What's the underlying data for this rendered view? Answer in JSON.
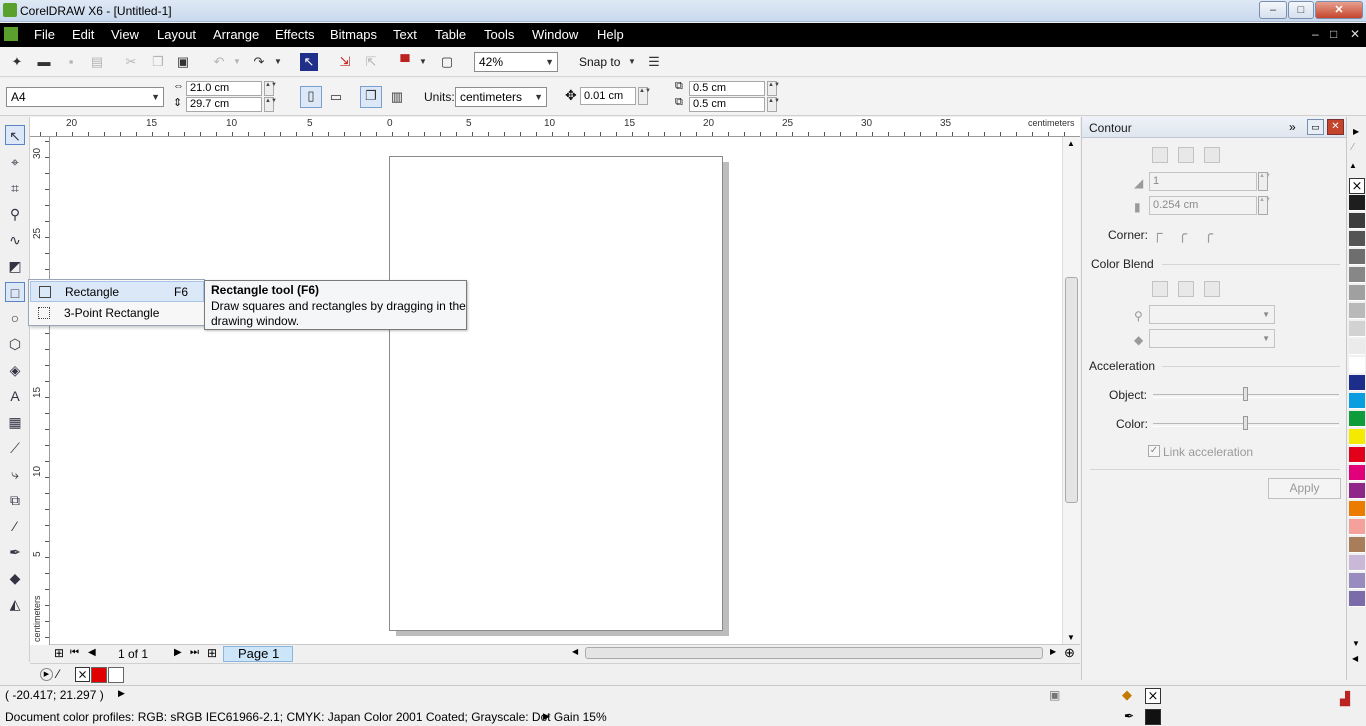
{
  "window": {
    "title": "CorelDRAW X6 - [Untitled-1]",
    "minimize": "–",
    "maximize": "□",
    "close": "✕"
  },
  "menu": [
    {
      "label": "File"
    },
    {
      "label": "Edit"
    },
    {
      "label": "View"
    },
    {
      "label": "Layout"
    },
    {
      "label": "Arrange"
    },
    {
      "label": "Effects"
    },
    {
      "label": "Bitmaps"
    },
    {
      "label": "Text"
    },
    {
      "label": "Table"
    },
    {
      "label": "Tools"
    },
    {
      "label": "Window"
    },
    {
      "label": "Help"
    }
  ],
  "menu_doc_controls": {
    "minimize": "–",
    "restore": "□",
    "close": "✕"
  },
  "standard_toolbar": {
    "zoom": "42%",
    "snap_to": "Snap to",
    "icons": [
      "new-icon",
      "open-icon",
      "save-icon",
      "print-icon",
      "cut-icon",
      "copy-icon",
      "paste-icon",
      "undo-icon",
      "redo-icon",
      "corel-connect-icon",
      "import-icon",
      "export-icon",
      "publish-pdf-icon",
      "app-launcher-icon",
      "full-screen-icon",
      "options-icon"
    ]
  },
  "property_bar": {
    "paper_size": "A4",
    "width": "21.0 cm",
    "height": "29.7 cm",
    "units_label": "Units:",
    "units": "centimeters",
    "nudge": "0.01 cm",
    "dup_x": "0.5 cm",
    "dup_y": "0.5 cm"
  },
  "rulers": {
    "unit_label": "centimeters",
    "h_ticks": [
      "20",
      "15",
      "10",
      "5",
      "0",
      "5",
      "10",
      "15",
      "20",
      "25",
      "30",
      "35"
    ],
    "v_ticks": [
      "30",
      "25",
      "20",
      "15",
      "10",
      "5"
    ]
  },
  "flyout": {
    "items": [
      {
        "label": "Rectangle",
        "shortcut": "F6"
      },
      {
        "label": "3-Point Rectangle",
        "shortcut": ""
      }
    ]
  },
  "tooltip": {
    "title": "Rectangle tool (F6)",
    "body": "Draw squares and rectangles by dragging in the drawing window."
  },
  "page_nav": {
    "counter": "1 of 1",
    "tab": "Page 1"
  },
  "status": {
    "coords": "( -20.417; 21.297 )",
    "color_profiles": "Document color profiles: RGB: sRGB IEC61966-2.1; CMYK: Japan Color 2001 Coated; Grayscale: Dot Gain 15%"
  },
  "docker": {
    "title": "Contour",
    "steps": "1",
    "offset": "0.254 cm",
    "corner_label": "Corner:",
    "color_blend_label": "Color Blend",
    "acceleration_label": "Acceleration",
    "object_label": "Object:",
    "color_label": "Color:",
    "link_acceleration": "Link acceleration",
    "apply": "Apply",
    "object_acceleration": 0.5,
    "color_acceleration": 0.5
  },
  "colors": {
    "document_palette": [
      "#e00000",
      "#ffffff"
    ],
    "palette": [
      "#1e1e1e",
      "#3c3c3c",
      "#555555",
      "#6e6e6e",
      "#878787",
      "#a0a0a0",
      "#b9b9b9",
      "#d2d2d2",
      "#ebebeb",
      "#ffffff",
      "#1c2d8c",
      "#0a9de0",
      "#0e9c3b",
      "#f4ea00",
      "#e3001b",
      "#e2007a",
      "#8e2788",
      "#ec7c00",
      "#f5a19b",
      "#a87e5a",
      "#c9b8d8",
      "#9a8bbf",
      "#7b6ba8"
    ]
  }
}
